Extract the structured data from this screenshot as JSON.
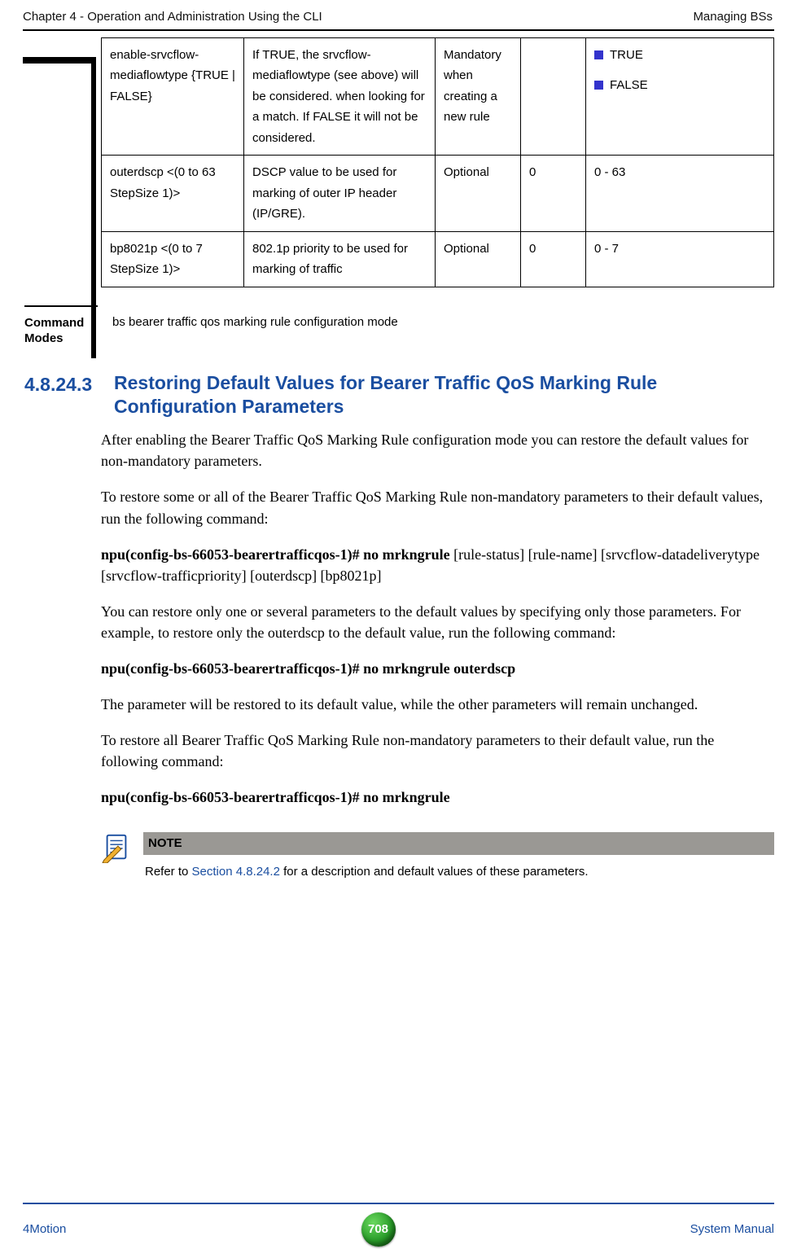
{
  "header": {
    "left": "Chapter 4 - Operation and Administration Using the CLI",
    "right": "Managing BSs"
  },
  "table": {
    "rows": [
      {
        "c1": "enable-srvcflow-mediaflowtype {TRUE | FALSE}",
        "c2": "If TRUE, the srvcflow-mediaflowtype (see above) will be considered. when looking for a match. If FALSE it will not be considered.",
        "c3": "Mandatory when creating a new rule",
        "c4": "",
        "c5a": "TRUE",
        "c5b": "FALSE"
      },
      {
        "c1": "outerdscp <(0 to 63 StepSize 1)>",
        "c2": "DSCP value to be used for marking of outer IP header (IP/GRE).",
        "c3": "Optional",
        "c4": "0",
        "c5": "0 - 63"
      },
      {
        "c1": "bp8021p <(0 to 7 StepSize 1)>",
        "c2": "802.1p priority to be used for marking of traffic",
        "c3": "Optional",
        "c4": "0",
        "c5": "0 - 7"
      }
    ]
  },
  "command_modes": {
    "label": "Command Modes",
    "value": "bs bearer traffic qos marking rule configuration mode"
  },
  "section": {
    "num": "4.8.24.3",
    "title": "Restoring Default Values for Bearer Traffic QoS Marking Rule Configuration Parameters"
  },
  "paras": {
    "p1": "After enabling the Bearer Traffic QoS Marking Rule configuration mode you can restore the default values for non-mandatory parameters.",
    "p2": "To restore some or all of the Bearer Traffic QoS Marking Rule non-mandatory parameters to their default values, run the following command:",
    "p3_bold": "npu(config-bs-66053-bearertrafficqos-1)# no mrkngrule",
    "p3_rest": " [rule-status] [rule-name] [srvcflow-datadeliverytype [srvcflow-trafficpriority] [outerdscp] [bp8021p]",
    "p4": "You can restore only one or several parameters to the default values by specifying only those parameters. For example, to restore only the outerdscp to the default value, run the following command:",
    "p5_bold": "npu(config-bs-66053-bearertrafficqos-1)# no mrkngrule outerdscp",
    "p6": "The parameter will be restored to its default value, while the other parameters will remain unchanged.",
    "p7": "To restore all Bearer Traffic QoS Marking Rule non-mandatory parameters to their default value, run the following command:",
    "p8_bold": "npu(config-bs-66053-bearertrafficqos-1)# no mrkngrule"
  },
  "note": {
    "header": "NOTE",
    "prefix": "Refer to ",
    "link": "Section 4.8.24.2",
    "suffix": " for a description and default values of these parameters."
  },
  "footer": {
    "left": "4Motion",
    "page": "708",
    "right": "System Manual"
  }
}
